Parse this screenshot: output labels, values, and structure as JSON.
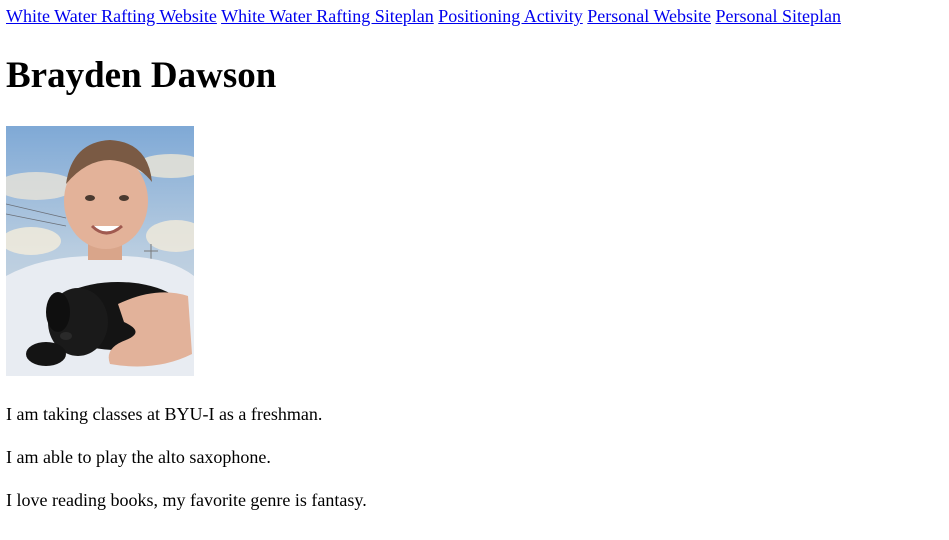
{
  "nav": {
    "links": [
      "White Water Rafting Website",
      "White Water Rafting Siteplan",
      "Positioning Activity",
      "Personal Website",
      "Personal Siteplan"
    ]
  },
  "profile": {
    "name": "Brayden Dawson"
  },
  "facts": [
    "I am taking classes at BYU-I as a freshman.",
    "I am able to play the alto saxophone.",
    "I love reading books, my favorite genre is fantasy."
  ],
  "colors": {
    "link": "#0000ee",
    "text": "#000000",
    "background": "#ffffff"
  }
}
